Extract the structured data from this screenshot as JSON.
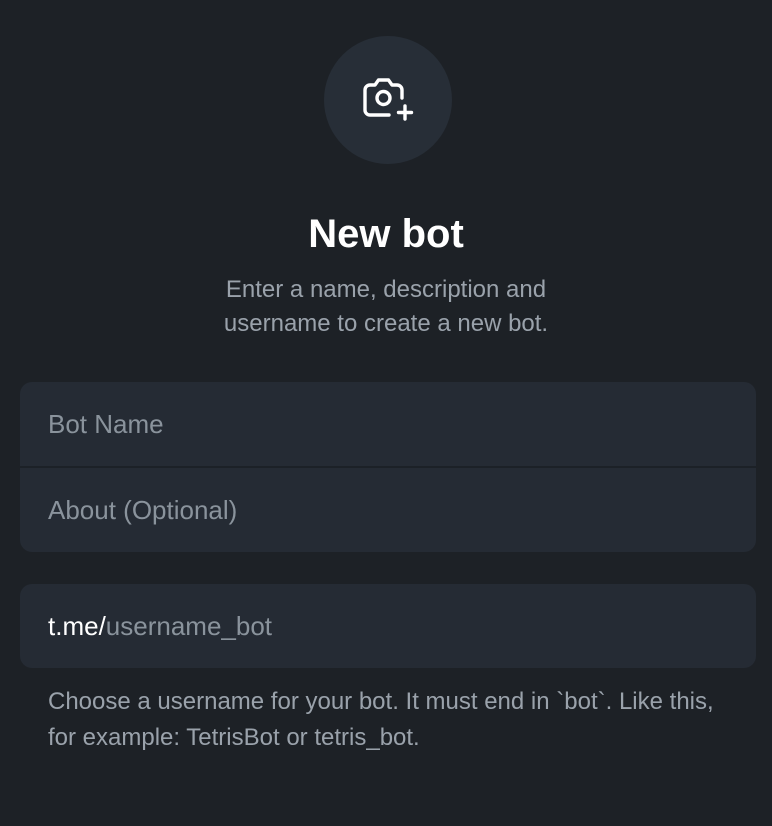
{
  "header": {
    "title": "New bot",
    "subtitle": "Enter a name, description and username to create a new bot."
  },
  "avatar": {
    "icon": "camera-add-icon"
  },
  "form": {
    "name_placeholder": "Bot Name",
    "about_placeholder": "About (Optional)",
    "username_prefix": "t.me/",
    "username_placeholder": "username_bot",
    "hint": "Choose a username for your bot. It must end in `bot`. Like this, for example: TetrisBot or tetris_bot."
  },
  "colors": {
    "background": "#1d2126",
    "card": "#252b34",
    "avatar_circle": "#272e37",
    "text_primary": "#ffffff",
    "text_secondary": "#9aa2ab"
  }
}
